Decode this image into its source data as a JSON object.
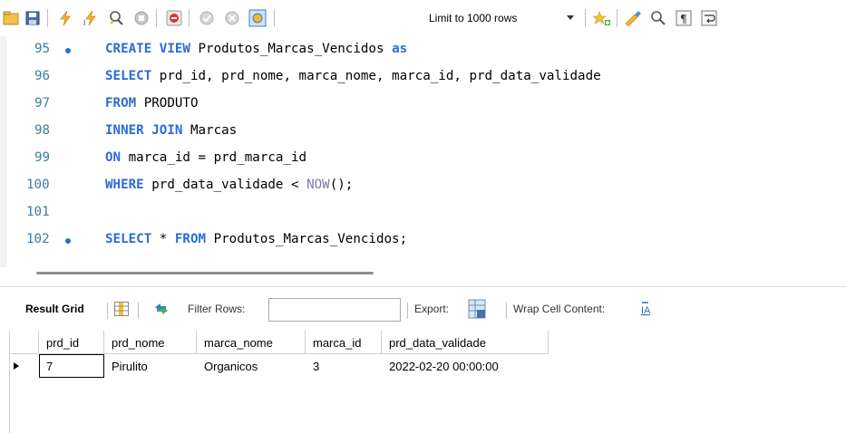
{
  "toolbar": {
    "limit_label": "Limit to 1000 rows",
    "buttons": [
      {
        "name": "open-folder-icon"
      },
      {
        "name": "save-icon"
      },
      {
        "name": "execute-lightning-icon"
      },
      {
        "name": "execute-cursor-lightning-icon"
      },
      {
        "name": "explain-magnifier-icon"
      },
      {
        "name": "stop-icon"
      },
      {
        "name": "toggle-continue-on-error-icon"
      },
      {
        "name": "commit-icon"
      },
      {
        "name": "rollback-icon"
      },
      {
        "name": "autocommit-toggle-icon"
      },
      {
        "name": "beautify-icon"
      },
      {
        "name": "beautify-brush-icon"
      },
      {
        "name": "find-icon"
      },
      {
        "name": "invisible-chars-icon"
      },
      {
        "name": "word-wrap-icon"
      }
    ]
  },
  "editor": {
    "lines": [
      {
        "num": "95",
        "marker": true,
        "parts": [
          {
            "t": "CREATE VIEW",
            "c": "kw"
          },
          {
            "t": " Produtos_Marcas_Vencidos ",
            "c": ""
          },
          {
            "t": "as",
            "c": "kw"
          }
        ]
      },
      {
        "num": "96",
        "marker": false,
        "parts": [
          {
            "t": "SELECT",
            "c": "kw"
          },
          {
            "t": " prd_id, prd_nome, marca_nome, marca_id, prd_data_validade",
            "c": ""
          }
        ]
      },
      {
        "num": "97",
        "marker": false,
        "parts": [
          {
            "t": "FROM",
            "c": "kw"
          },
          {
            "t": " PRODUTO",
            "c": ""
          }
        ]
      },
      {
        "num": "98",
        "marker": false,
        "parts": [
          {
            "t": "INNER JOIN",
            "c": "kw"
          },
          {
            "t": " Marcas",
            "c": ""
          }
        ]
      },
      {
        "num": "99",
        "marker": false,
        "parts": [
          {
            "t": "ON",
            "c": "kw"
          },
          {
            "t": " marca_id = prd_marca_id",
            "c": ""
          }
        ]
      },
      {
        "num": "100",
        "marker": false,
        "parts": [
          {
            "t": "WHERE",
            "c": "kw"
          },
          {
            "t": " prd_data_validade < ",
            "c": ""
          },
          {
            "t": "NOW",
            "c": "fn"
          },
          {
            "t": "();",
            "c": ""
          }
        ]
      },
      {
        "num": "101",
        "marker": false,
        "parts": []
      },
      {
        "num": "102",
        "marker": true,
        "parts": [
          {
            "t": "SELECT",
            "c": "kw"
          },
          {
            "t": " * ",
            "c": ""
          },
          {
            "t": "FROM",
            "c": "kw"
          },
          {
            "t": " Produtos_Marcas_Vencidos;",
            "c": ""
          }
        ]
      }
    ]
  },
  "result_bar": {
    "result_grid": "Result Grid",
    "filter_rows": "Filter Rows:",
    "filter_value": "",
    "export": "Export:",
    "wrap": "Wrap Cell Content:"
  },
  "grid": {
    "columns": [
      "prd_id",
      "prd_nome",
      "marca_nome",
      "marca_id",
      "prd_data_validade"
    ],
    "rows": [
      [
        "7",
        "Pirulito",
        "Organicos",
        "3",
        "2022-02-20 00:00:00"
      ]
    ]
  },
  "colors": {
    "keyword": "#2b6bd6",
    "line_number": "#3a7ca5",
    "marker": "#1f77d0"
  }
}
